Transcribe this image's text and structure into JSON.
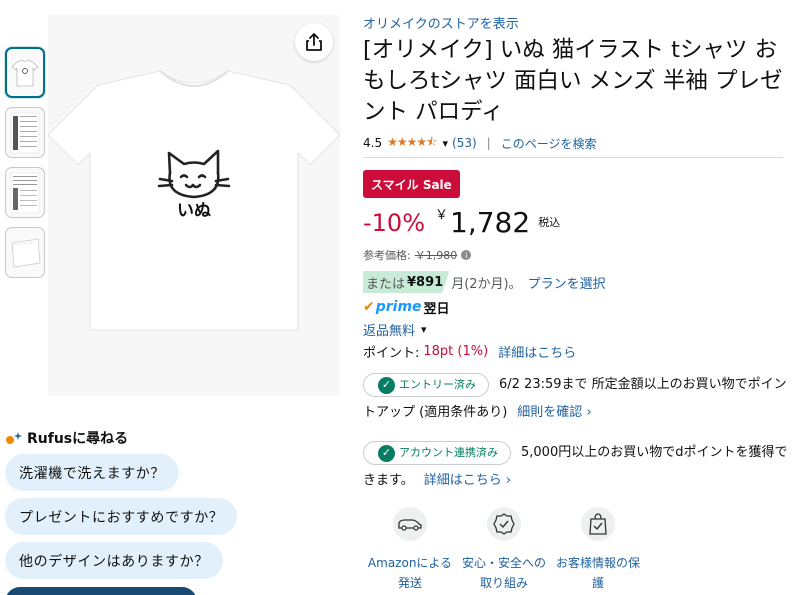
{
  "gallery": {
    "thumbnails": [
      "thumb-front",
      "thumb-sizechart-1",
      "thumb-sizechart-2",
      "thumb-folded"
    ],
    "main_image_text": "いぬ",
    "share_icon": "share-icon"
  },
  "rufus": {
    "title": "Rufusに尋ねる",
    "questions": [
      "洗濯機で洗えますか？",
      "プレゼントにおすすめですか？",
      "他のデザインはありますか？"
    ]
  },
  "product": {
    "store_link": "オリメイクのストアを表示",
    "title": "[オリメイク] いぬ 猫イラスト tシャツ おもしろtシャツ 面白い メンズ 半袖 プレゼント パロディ",
    "rating": "4.5",
    "stars": "★★★★⯪",
    "rating_count": "(53)",
    "search_page": "このページを検索"
  },
  "pricing": {
    "sale_badge": "スマイル Sale",
    "discount": "-10%",
    "currency": "￥",
    "price": "1,782",
    "tax": "税込",
    "ref_label": "参考価格:",
    "ref_price": "￥1,980",
    "install_prefix": "または",
    "install_amount": "¥891",
    "install_suffix": "月(2か月)。",
    "install_link": "プランを選択"
  },
  "delivery": {
    "prime_word": "prime",
    "prime_day": "翌日",
    "returns": "返品無料"
  },
  "points": {
    "label": "ポイント:",
    "value": "18pt  (1%)",
    "details_link": "詳細はこちら"
  },
  "campaigns": [
    {
      "badge": "エントリー済み",
      "text": "6/2 23:59まで 所定金額以上のお買い物でポイントアップ (適用条件あり)",
      "link": "細則を確認 ›"
    },
    {
      "badge": "アカウント連携済み",
      "text": "5,000円以上のお買い物でdポイントを獲得できます。",
      "link": "詳細はこちら ›"
    }
  ],
  "features": [
    {
      "icon": "delivery-van-icon",
      "label": "Amazonによる発送"
    },
    {
      "icon": "safety-badge-icon",
      "label": "安心・安全への取り組み"
    },
    {
      "icon": "secure-bag-icon",
      "label": "お客様情報の保護"
    }
  ],
  "colors": {
    "link": "#2162a1",
    "sale": "#cc0c39",
    "star": "#de7921",
    "success": "#067d62",
    "prime": "#1a98ff"
  }
}
